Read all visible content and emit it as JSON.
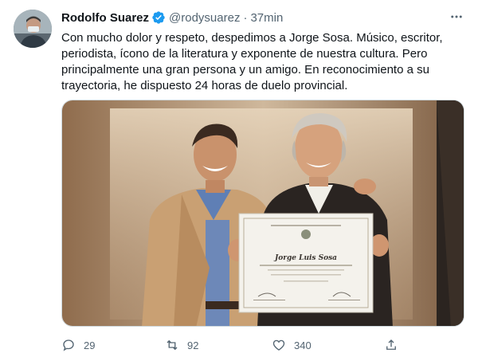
{
  "tweet": {
    "author_name": "Rodolfo Suarez",
    "handle": "@rodysuarez",
    "separator": "·",
    "time": "37min",
    "text_lines": [
      "Con mucho dolor y respeto, despedimos a Jorge Sosa. Músico, escritor,",
      "periodista, ícono de la literatura y exponente de nuestra cultura. Pero",
      "principalmente una gran persona y un amigo. En reconocimiento a su",
      "trayectoria, he dispuesto 24 horas de duelo provincial."
    ],
    "certificate_name": "Jorge Luis Sosa"
  },
  "actions": {
    "replies": "29",
    "retweets": "92",
    "likes": "340"
  },
  "icons": [
    "verified-badge-icon",
    "more-icon",
    "reply-icon",
    "retweet-icon",
    "like-icon",
    "share-icon"
  ],
  "colors": {
    "verified": "#1d9bf0",
    "secondary_text": "#536471",
    "primary_text": "#0f1419"
  }
}
